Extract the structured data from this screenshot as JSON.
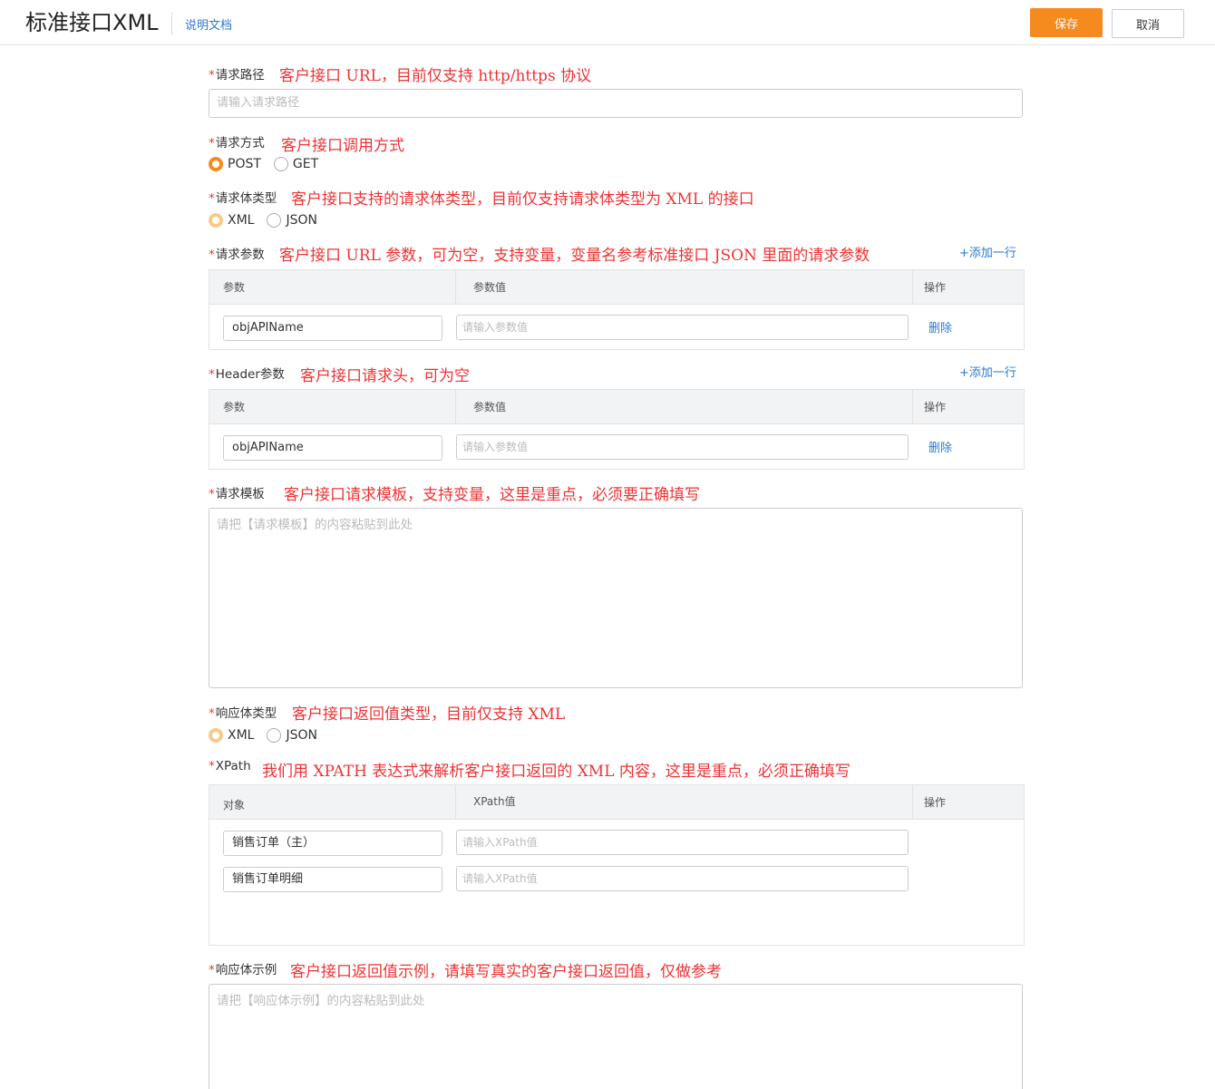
{
  "header": {
    "title": "标准接口XML",
    "doc_link": "说明文档",
    "save_label": "保存",
    "cancel_label": "取消"
  },
  "required_mark": "*",
  "fields": {
    "path": {
      "label": "请求路径",
      "note": "客户接口 URL，目前仅支持 http/https 协议",
      "placeholder": "请输入请求路径"
    },
    "method": {
      "label": "请求方式",
      "note": "客户接口调用方式",
      "options": [
        "POST",
        "GET"
      ],
      "selected": "POST"
    },
    "body_type": {
      "label": "请求体类型",
      "note": "客户接口支持的请求体类型，目前仅支持请求体类型为 XML 的接口",
      "options": [
        "XML",
        "JSON"
      ],
      "selected": "XML"
    },
    "params": {
      "label": "请求参数",
      "note": "客户接口 URL 参数，可为空，支持变量，变量名参考标准接口 JSON 里面的请求参数",
      "add_row": "+添加一行",
      "columns": [
        "参数",
        "参数值",
        "操作"
      ],
      "rows": [
        {
          "name": "objAPIName",
          "value_placeholder": "请输入参数值",
          "action": "删除"
        }
      ]
    },
    "headers": {
      "label": "Header参数",
      "note": "客户接口请求头，可为空",
      "add_row": "+添加一行",
      "columns": [
        "参数",
        "参数值",
        "操作"
      ],
      "rows": [
        {
          "name": "objAPIName",
          "value_placeholder": "请输入参数值",
          "action": "删除"
        }
      ]
    },
    "template": {
      "label": "请求模板",
      "note": "客户接口请求模板，支持变量，这里是重点，必须要正确填写",
      "placeholder": "请把【请求模板】的内容粘贴到此处"
    },
    "response_type": {
      "label": "响应体类型",
      "note": "客户接口返回值类型，目前仅支持 XML",
      "options": [
        "XML",
        "JSON"
      ],
      "selected": "XML"
    },
    "xpath": {
      "label": "XPath",
      "note": "我们用 XPATH 表达式来解析客户接口返回的 XML 内容，这里是重点，必须正确填写",
      "columns": [
        "对象",
        "XPath值",
        "操作"
      ],
      "rows": [
        {
          "object": "销售订单（主）",
          "value_placeholder": "请输入XPath值"
        },
        {
          "object": "销售订单明细",
          "value_placeholder": "请输入XPath值"
        }
      ]
    },
    "response_example": {
      "label": "响应体示例",
      "note": "客户接口返回值示例，请填写真实的客户接口返回值，仅做参考",
      "placeholder": "请把【响应体示例】的内容粘贴到此处"
    }
  }
}
